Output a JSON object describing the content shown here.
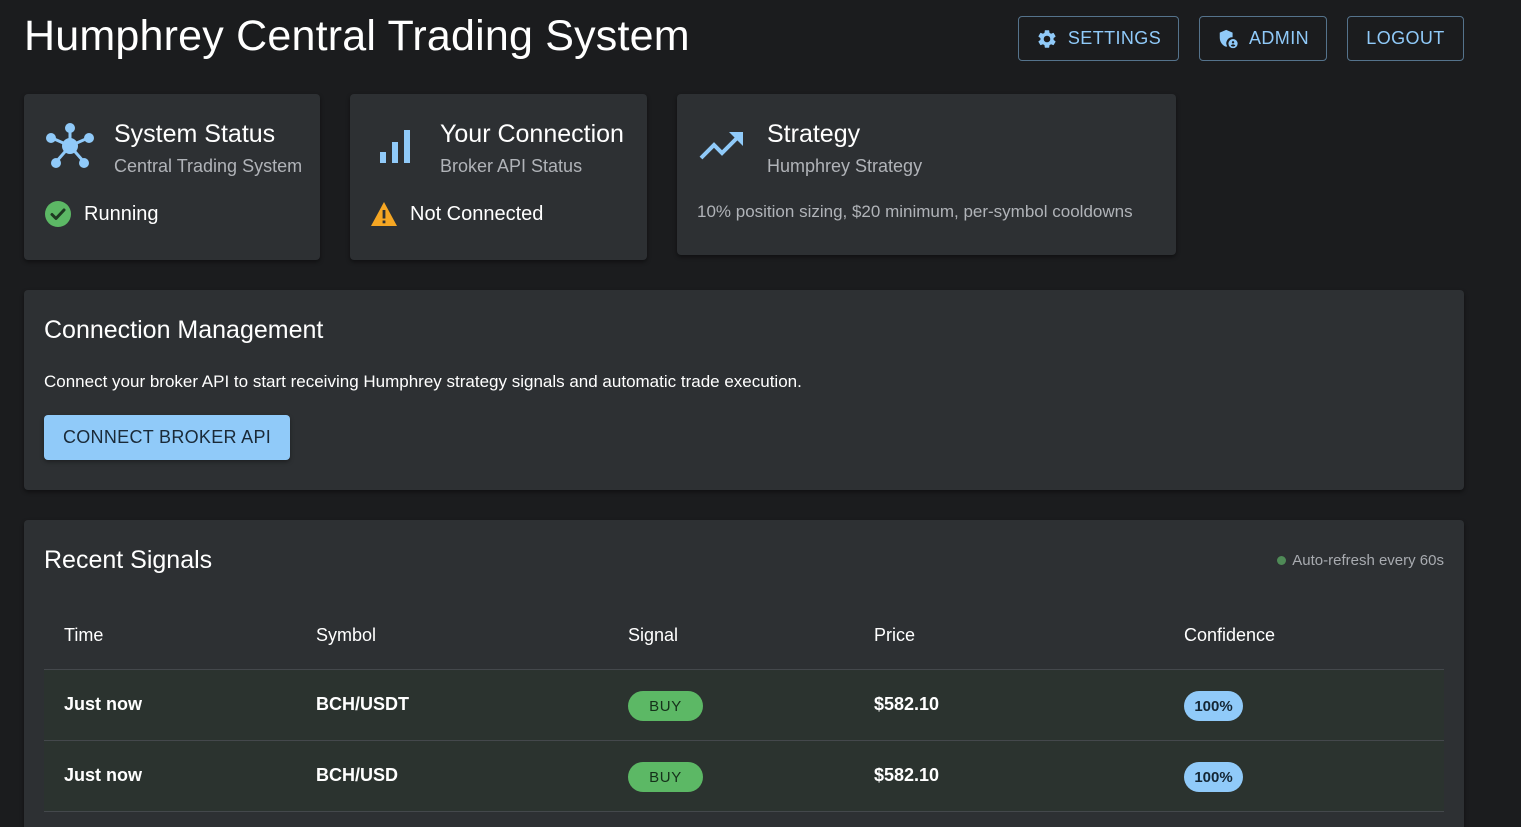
{
  "header": {
    "title": "Humphrey Central Trading System",
    "buttons": {
      "settings": "SETTINGS",
      "admin": "ADMIN",
      "logout": "LOGOUT"
    }
  },
  "cards": {
    "system": {
      "title": "System Status",
      "subtitle": "Central Trading System",
      "status": "Running",
      "icon": "hub-icon",
      "status_icon": "check-circle-icon"
    },
    "connection": {
      "title": "Your Connection",
      "subtitle": "Broker API Status",
      "status": "Not Connected",
      "icon": "signal-bars-icon",
      "status_icon": "warning-icon"
    },
    "strategy": {
      "title": "Strategy",
      "subtitle": "Humphrey Strategy",
      "description": "10% position sizing, $20 minimum, per-symbol cooldowns",
      "icon": "trending-up-icon"
    }
  },
  "connection_management": {
    "title": "Connection Management",
    "description": "Connect your broker API to start receiving Humphrey strategy signals and automatic trade execution.",
    "button": "CONNECT BROKER API"
  },
  "signals": {
    "title": "Recent Signals",
    "refresh_text": "Auto-refresh every 60s",
    "columns": [
      "Time",
      "Symbol",
      "Signal",
      "Price",
      "Confidence"
    ],
    "rows": [
      {
        "time": "Just now",
        "symbol": "BCH/USDT",
        "signal": "BUY",
        "price": "$582.10",
        "confidence": "100%"
      },
      {
        "time": "Just now",
        "symbol": "BCH/USD",
        "signal": "BUY",
        "price": "$582.10",
        "confidence": "100%"
      }
    ]
  },
  "colors": {
    "background": "#1b1c1e",
    "card": "#2d3033",
    "accent": "#90caf9",
    "success": "#5cb865",
    "warning": "#f5a623"
  }
}
